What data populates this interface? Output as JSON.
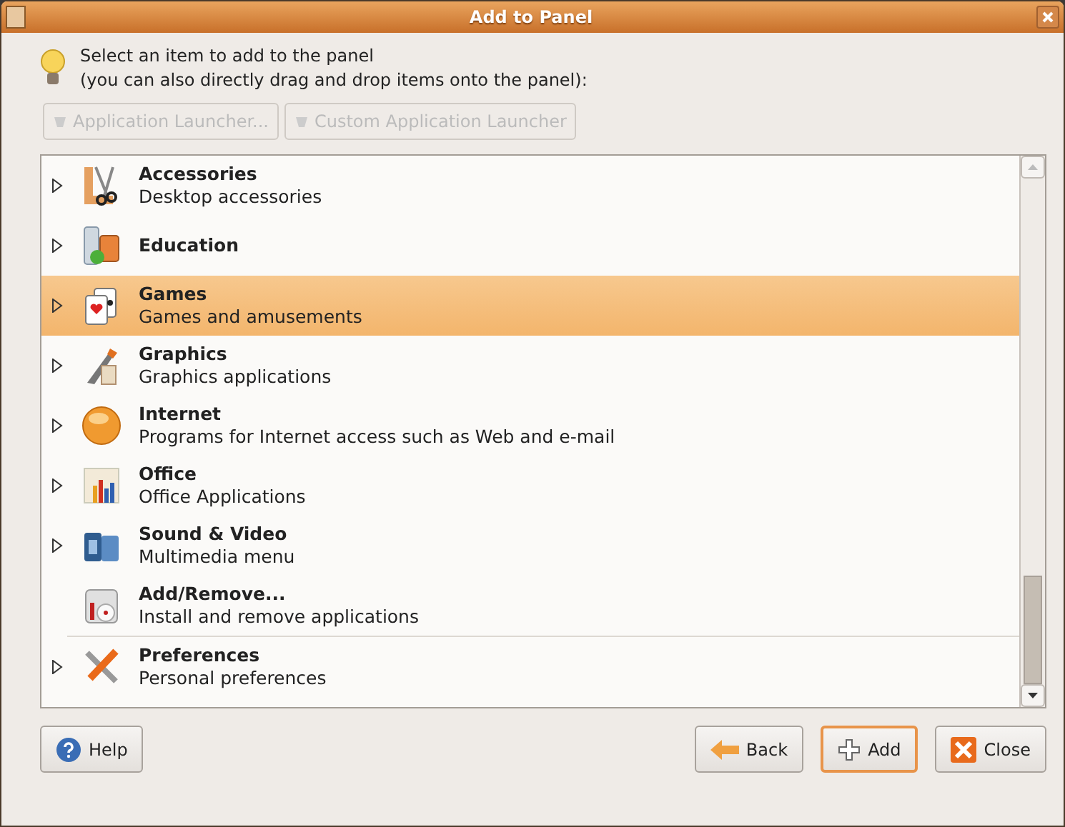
{
  "window": {
    "title": "Add to Panel"
  },
  "hint": {
    "lines": [
      "Select an item to add to the panel",
      "(you can also directly drag and drop items onto the panel):"
    ]
  },
  "launcher_buttons": [
    {
      "label": "Application Launcher...",
      "disabled": true
    },
    {
      "label": "Custom Application Launcher",
      "disabled": true
    }
  ],
  "items": [
    {
      "kind": "category",
      "name": "Accessories",
      "description": "Desktop accessories",
      "expanded": false,
      "selected": false
    },
    {
      "kind": "category",
      "name": "Education",
      "expanded": false,
      "selected": false
    },
    {
      "kind": "category",
      "name": "Games",
      "description": "Games and amusements",
      "expanded": false,
      "selected": true
    },
    {
      "kind": "category",
      "name": "Graphics",
      "description": "Graphics applications",
      "expanded": false,
      "selected": false
    },
    {
      "kind": "category",
      "name": "Internet",
      "description": "Programs for Internet access such as Web and e-mail",
      "expanded": false,
      "selected": false
    },
    {
      "kind": "category",
      "name": "Office",
      "description": "Office Applications",
      "expanded": false,
      "selected": false
    },
    {
      "kind": "category",
      "name": "Sound & Video",
      "description": "Multimedia menu",
      "expanded": false,
      "selected": false
    },
    {
      "kind": "launcher",
      "name": "Add/Remove...",
      "description": "Install and remove applications",
      "selected": false
    },
    {
      "kind": "category",
      "name": "Preferences",
      "description": "Personal preferences",
      "expanded": false,
      "selected": false
    }
  ],
  "buttons": [
    {
      "kind": "help",
      "label": "Help",
      "focused": false
    },
    {
      "kind": "back",
      "label": "Back",
      "focused": false
    },
    {
      "kind": "add",
      "label": "Add",
      "focused": true
    },
    {
      "kind": "close",
      "label": "Close",
      "focused": false
    }
  ]
}
